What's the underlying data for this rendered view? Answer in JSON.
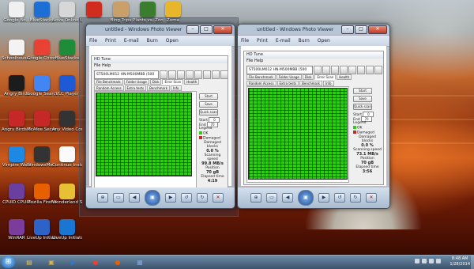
{
  "desktop": {
    "icons": [
      {
        "name": "google-books-icon",
        "label": "Google Bo...",
        "color": "#f0f0f0"
      },
      {
        "name": "bluestacks-icon",
        "label": "BlueStacks",
        "color": "#1d6fd6"
      },
      {
        "name": "nova-launcher-icon",
        "label": "Nova Online Upgrade",
        "color": "#d7d7d7"
      },
      {
        "name": "raiders-game-icon",
        "label": "",
        "color": "#d12d1f"
      },
      {
        "name": "photo-icon",
        "label": "Bing Trips",
        "color": "#c9a06a"
      },
      {
        "name": "plants-zombies-icon",
        "label": "Plants vs. Zombies",
        "color": "#3b7d2e"
      },
      {
        "name": "zuma-icon",
        "label": "Zuma",
        "color": "#e8b62a"
      },
      {
        "name": "schoolhouse-icon",
        "label": "Schoolhouse Tool",
        "color": "#f3f3f3"
      },
      {
        "name": "chrome-icon",
        "label": "Google Chrome",
        "color": "#e94235"
      },
      {
        "name": "bluestacks-app-icon",
        "label": "BlueStacks",
        "color": "#1f8c3a"
      },
      {
        "name": "google-search-icon",
        "label": "Google Search",
        "color": "#4285f4"
      },
      {
        "name": "vlc-player-icon",
        "label": "VLC Player",
        "color": "#1e5ad6"
      },
      {
        "name": "angry-birds-icon",
        "label": "Angry Birds",
        "color": "#1c1c1c"
      },
      {
        "name": "angry-birds-seasons-icon",
        "label": "Angry Birds Seasons",
        "color": "#c62828"
      },
      {
        "name": "mcafee-icon",
        "label": "McAfee Security Sc...",
        "color": "#c62828"
      },
      {
        "name": "video-converter-icon",
        "label": "Any Video Converter",
        "color": "#333"
      },
      {
        "name": "vimpire-icon",
        "label": "Vimpire Wars",
        "color": "#1e88e5"
      },
      {
        "name": "windows-media-icon",
        "label": "WindowsMe...",
        "color": "#333"
      },
      {
        "name": "control-panel-icon",
        "label": "Continue Installation",
        "color": "#fafafa"
      },
      {
        "name": "cpu-z-icon",
        "label": "CPUID CPU-Z",
        "color": "#6b3fa0"
      },
      {
        "name": "firefox-icon",
        "label": "Mozilla Firefox",
        "color": "#e66000"
      },
      {
        "name": "wonderland-icon",
        "label": "Wonderland Secret Wo...",
        "color": "#e8c034"
      },
      {
        "name": "winrar-icon",
        "label": "WinRAR",
        "color": "#7b3d9b"
      },
      {
        "name": "livehq-icon",
        "label": "LiveUp Initiator",
        "color": "#2d63c8"
      },
      {
        "name": "liveup-icon",
        "label": "LiveUp Initiator",
        "color": "#1976d2"
      }
    ]
  },
  "windows": [
    {
      "title": "untitled - Windows Photo Viewer",
      "menu": [
        "File",
        "Print",
        "E-mail",
        "Burn",
        "Open"
      ],
      "app": {
        "title": "HD Tune",
        "menu": "File   Help",
        "drive": "ST500LM012 HN-M500MBB (500 gB)",
        "tabs": [
          "File Benchmark",
          "Folder Usage",
          "Disk",
          "Error Scan",
          "Health",
          "Random Access",
          "Extra tests",
          "Benchmark",
          "Info"
        ],
        "buttons": [
          "Start",
          "Save",
          "Quick scan"
        ],
        "fields": [
          {
            "label": "Start",
            "value": "0"
          },
          {
            "label": "End",
            "value": "70"
          }
        ],
        "legend_title": "Legend",
        "legend": [
          {
            "label": "OK",
            "color": "#2ecc14"
          },
          {
            "label": "Damaged",
            "color": "#c62828"
          }
        ],
        "stats": [
          {
            "caption": "Damaged blocks",
            "value": "0.0 %"
          },
          {
            "caption": "Scanning speed",
            "value": "99.8 MB/s"
          },
          {
            "caption": "Position",
            "value": "70 gB"
          },
          {
            "caption": "Elapsed time",
            "value": "4:19"
          }
        ]
      }
    },
    {
      "title": "untitled - Windows Photo Viewer",
      "menu": [
        "File",
        "Print",
        "E-mail",
        "Burn",
        "Open"
      ],
      "app": {
        "title": "HD Tune",
        "menu": "File   Help",
        "drive": "ST500LM012 HN-M500MBB (500 gB)",
        "tabs": [
          "File Benchmark",
          "Folder Usage",
          "Disk",
          "Error Scan",
          "Health",
          "Random Access",
          "Extra tests",
          "Benchmark",
          "Info"
        ],
        "buttons": [
          "Start",
          "Save",
          "Quick scan"
        ],
        "fields": [
          {
            "label": "Start",
            "value": "0"
          },
          {
            "label": "End",
            "value": "70"
          }
        ],
        "legend_title": "Legend",
        "legend": [
          {
            "label": "OK",
            "color": "#2ecc14"
          },
          {
            "label": "Damaged",
            "color": "#c62828"
          }
        ],
        "stats": [
          {
            "caption": "Damaged blocks",
            "value": "0.0 %"
          },
          {
            "caption": "Scanning speed",
            "value": "73.1 MB/s"
          },
          {
            "caption": "Position",
            "value": "70 gB"
          },
          {
            "caption": "Elapsed time",
            "value": "3:56"
          }
        ]
      }
    }
  ],
  "taskbar": {
    "items": [
      {
        "name": "explorer-taskbar-icon",
        "glyph": "▤",
        "color": "#e3c25a"
      },
      {
        "name": "libraries-taskbar-icon",
        "glyph": "▣",
        "color": "#d9b34a"
      },
      {
        "name": "media-player-taskbar-icon",
        "glyph": "▶",
        "color": "#2f79d0"
      },
      {
        "name": "chrome-taskbar-icon",
        "glyph": "●",
        "color": "#e94235"
      },
      {
        "name": "firefox-taskbar-icon",
        "glyph": "●",
        "color": "#e66000"
      },
      {
        "name": "photo-viewer-taskbar-icon",
        "glyph": "▦",
        "color": "#7fa8d8"
      }
    ],
    "time": "8:48 AM",
    "date": "1/28/2014"
  }
}
